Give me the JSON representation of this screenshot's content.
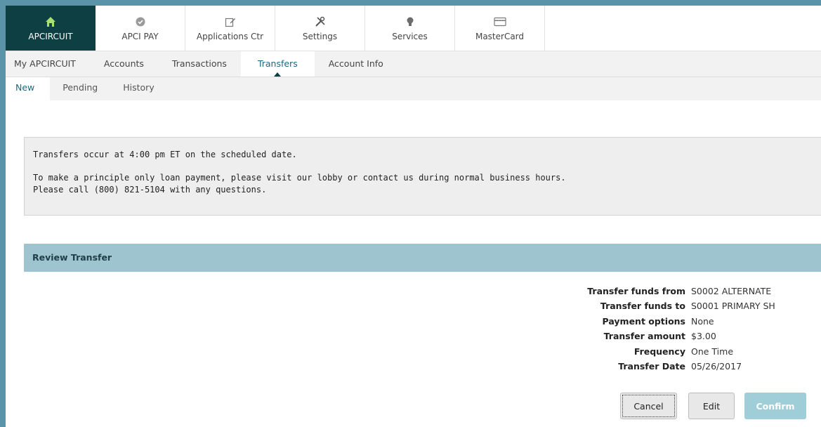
{
  "topnav": [
    {
      "label": "APCIRCUIT",
      "icon": "home-icon",
      "active": true
    },
    {
      "label": "APCI PAY",
      "icon": "check-circle-icon"
    },
    {
      "label": "Applications Ctr",
      "icon": "edit-form-icon"
    },
    {
      "label": "Settings",
      "icon": "tools-icon"
    },
    {
      "label": "Services",
      "icon": "lightbulb-icon"
    },
    {
      "label": "MasterCard",
      "icon": "credit-card-icon"
    }
  ],
  "subnav": [
    {
      "label": "My APCIRCUIT"
    },
    {
      "label": "Accounts"
    },
    {
      "label": "Transactions"
    },
    {
      "label": "Transfers",
      "active": true
    },
    {
      "label": "Account Info"
    }
  ],
  "tabs": [
    {
      "label": "New",
      "active": true
    },
    {
      "label": "Pending"
    },
    {
      "label": "History"
    }
  ],
  "notice": {
    "line1": "Transfers occur at 4:00 pm ET on the scheduled date.",
    "line2": "To make a principle only loan payment, please visit our lobby or contact us during normal business hours.",
    "line3": "Please call (800) 821-5104 with any questions."
  },
  "review": {
    "title": "Review Transfer",
    "rows": [
      {
        "label": "Transfer funds from",
        "value": "S0002 ALTERNATE"
      },
      {
        "label": "Transfer funds to",
        "value": "S0001 PRIMARY SH"
      },
      {
        "label": "Payment options",
        "value": "None"
      },
      {
        "label": "Transfer amount",
        "value": "$3.00"
      },
      {
        "label": "Frequency",
        "value": "One Time"
      },
      {
        "label": "Transfer Date",
        "value": "05/26/2017"
      }
    ],
    "cancel_label": "Cancel",
    "edit_label": "Edit",
    "confirm_label": "Confirm"
  },
  "colors": {
    "brand_dark": "#0e3f42",
    "panel_header": "#9ec4cf",
    "confirm_disabled": "#9fcdd8",
    "outer_border": "#5b93a8"
  }
}
